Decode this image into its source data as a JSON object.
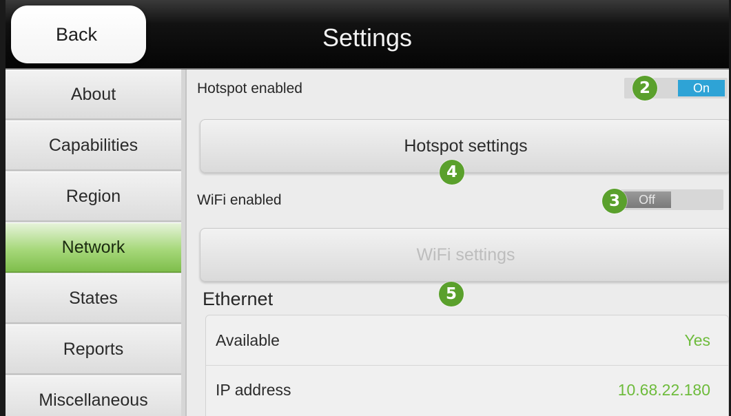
{
  "header": {
    "back_label": "Back",
    "title": "Settings"
  },
  "sidebar": {
    "items": [
      {
        "label": "About"
      },
      {
        "label": "Capabilities"
      },
      {
        "label": "Region"
      },
      {
        "label": "Network",
        "active": true
      },
      {
        "label": "States"
      },
      {
        "label": "Reports"
      },
      {
        "label": "Miscellaneous"
      }
    ]
  },
  "network": {
    "hotspot": {
      "label": "Hotspot enabled",
      "state": "On",
      "enabled": true
    },
    "hotspot_settings_label": "Hotspot settings",
    "wifi": {
      "label": "WiFi enabled",
      "state": "Off",
      "enabled": false
    },
    "wifi_settings_label": "WiFi settings",
    "ethernet": {
      "title": "Ethernet",
      "rows": [
        {
          "label": "Available",
          "value": "Yes"
        },
        {
          "label": "IP address",
          "value": "10.68.22.180"
        }
      ]
    }
  },
  "callouts": [
    "2",
    "3",
    "4",
    "5"
  ],
  "colors": {
    "accent_green": "#7fbe4c",
    "toggle_on": "#2ea3d6",
    "value_green": "#6dbb3b",
    "badge_green": "#5aa02c"
  }
}
